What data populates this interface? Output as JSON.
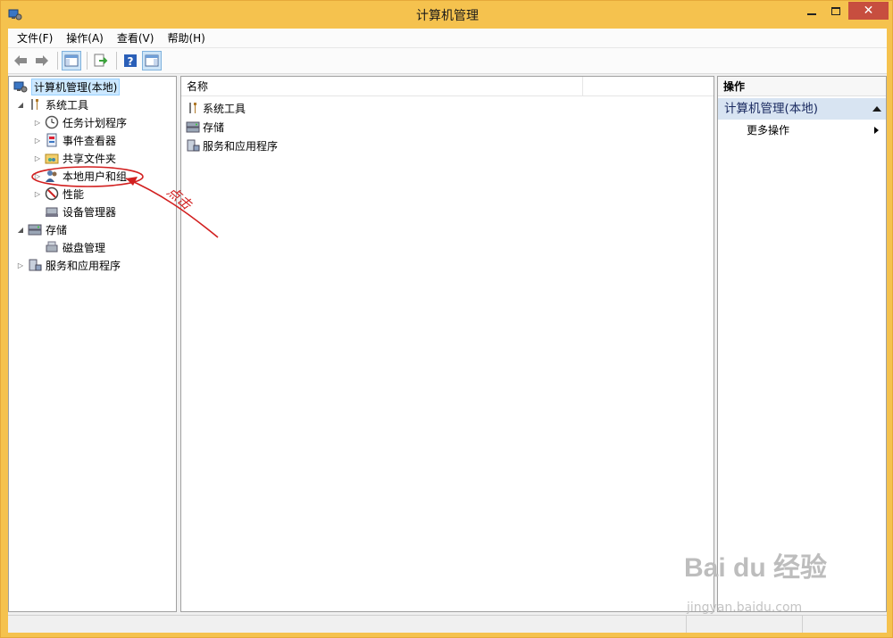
{
  "window": {
    "title": "计算机管理"
  },
  "menu": [
    "文件(F)",
    "操作(A)",
    "查看(V)",
    "帮助(H)"
  ],
  "tree": {
    "root": "计算机管理(本地)",
    "system_tools": "系统工具",
    "task_scheduler": "任务计划程序",
    "event_viewer": "事件查看器",
    "shared_folders": "共享文件夹",
    "local_users": "本地用户和组",
    "performance": "性能",
    "device_manager": "设备管理器",
    "storage": "存储",
    "disk_management": "磁盘管理",
    "services_apps": "服务和应用程序"
  },
  "list": {
    "column_name": "名称",
    "rows": [
      "系统工具",
      "存储",
      "服务和应用程序"
    ]
  },
  "actions": {
    "header": "操作",
    "section": "计算机管理(本地)",
    "more": "更多操作"
  },
  "annotation": {
    "text": "点击"
  },
  "watermark": {
    "brand": "Bai du 经验",
    "url": "jingyan.baidu.com"
  },
  "colors": {
    "title_bg": "#f5c24e",
    "close_btn": "#c74e3f",
    "annotation": "#d21f1f",
    "action_section_bg": "#d8e4f2"
  }
}
